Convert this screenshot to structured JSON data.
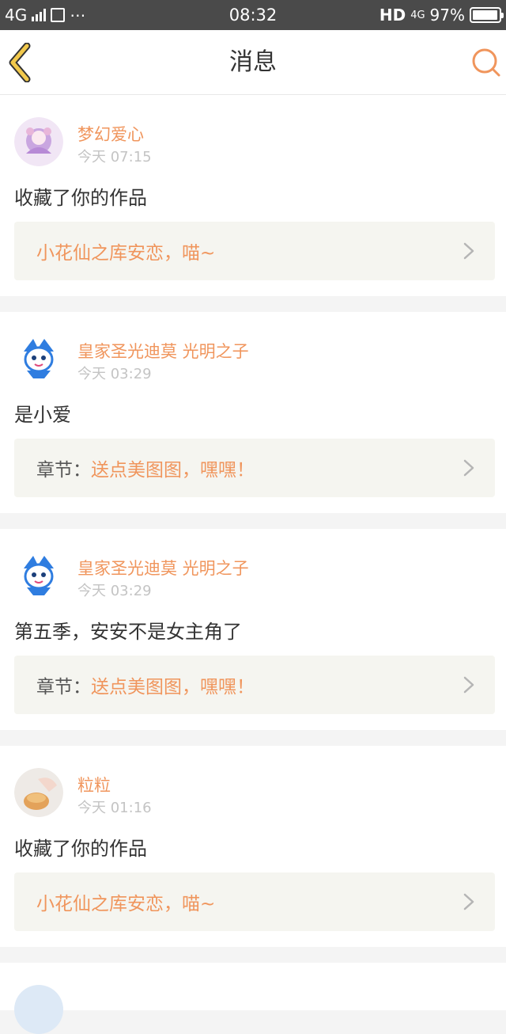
{
  "status_bar": {
    "network": "4G",
    "time": "08:32",
    "hd": "HD",
    "network_right": "4G",
    "battery": "97%",
    "battery_level": 0.97
  },
  "header": {
    "title": "消息",
    "back_icon": "chevron-left-icon",
    "search_icon": "search-icon",
    "accent_color": "#f0955c"
  },
  "messages": [
    {
      "username": "梦幻爱心",
      "time": "今天 07:15",
      "text": "收藏了你的作品",
      "ref_prefix": "",
      "ref_text": "小花仙之库安恋，喵~"
    },
    {
      "username": "皇家圣光迪莫 光明之子",
      "time": "今天 03:29",
      "text": "是小爱",
      "ref_prefix": "章节：",
      "ref_text": "送点美图图，嘿嘿！"
    },
    {
      "username": "皇家圣光迪莫 光明之子",
      "time": "今天 03:29",
      "text": "第五季，安安不是女主角了",
      "ref_prefix": "章节：",
      "ref_text": "送点美图图，嘿嘿！"
    },
    {
      "username": "粒粒",
      "time": "今天 01:16",
      "text": "收藏了你的作品",
      "ref_prefix": "",
      "ref_text": "小花仙之库安恋，喵~"
    }
  ]
}
